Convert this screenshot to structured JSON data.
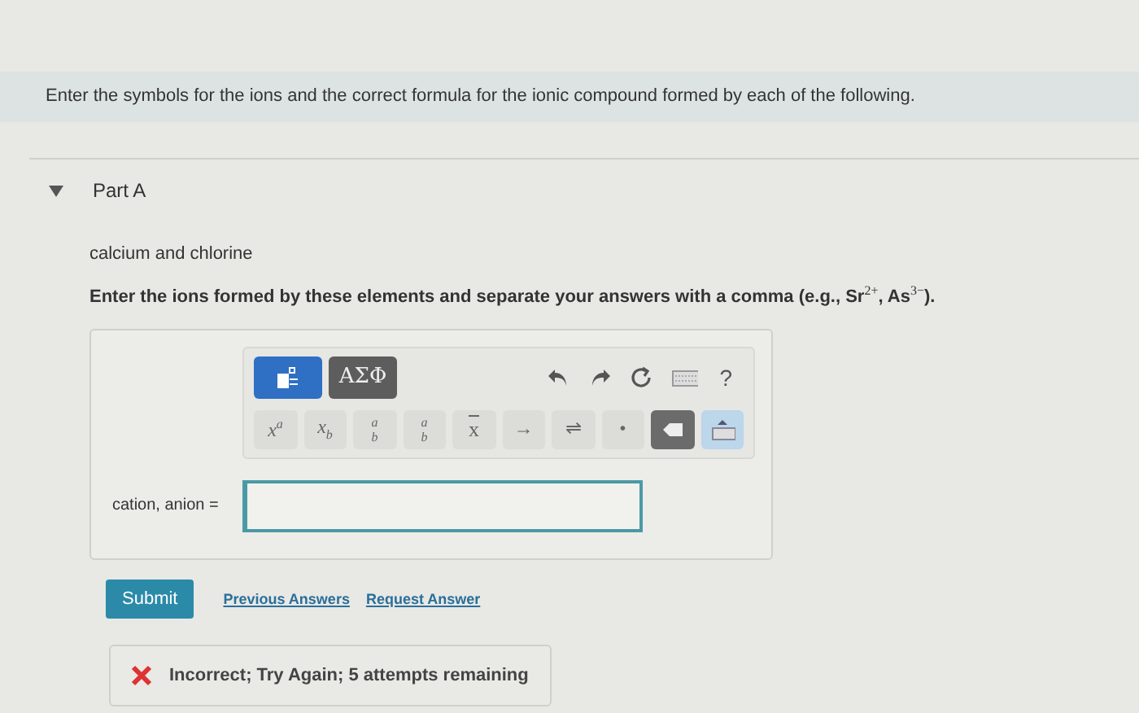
{
  "instructions": "Enter the symbols for the ions and the correct formula for the ionic compound formed by each of the following.",
  "part": {
    "title": "Part A",
    "expanded": true
  },
  "elements": "calcium and chlorine",
  "prompt": "Enter the ions formed by these elements and separate your answers with a comma (e.g., Sr$^{2+}$, As$^{3−}$).",
  "toolbar_top": [
    {
      "kind": "templates",
      "selected": true
    },
    {
      "kind": "symbols",
      "label": "ΑΣΦ",
      "selected": false
    },
    {
      "kind": "undo"
    },
    {
      "kind": "redo"
    },
    {
      "kind": "reset"
    },
    {
      "kind": "keyboard"
    },
    {
      "kind": "help",
      "label": "?"
    }
  ],
  "toolbar_bottom": [
    {
      "kind": "superscript",
      "base": "x",
      "script": "a"
    },
    {
      "kind": "subscript",
      "base": "x",
      "script": "b"
    },
    {
      "kind": "stack",
      "top": "a",
      "bottom": "b"
    },
    {
      "kind": "fraction",
      "top": "a",
      "bottom": "b"
    },
    {
      "kind": "bar",
      "base": "x"
    },
    {
      "kind": "glyph",
      "label": "→"
    },
    {
      "kind": "glyph",
      "label": "⇌"
    },
    {
      "kind": "glyph",
      "label": "•"
    },
    {
      "kind": "backspace"
    },
    {
      "kind": "keyboard-toggle"
    }
  ],
  "answer": {
    "label": "cation, anion ="
  },
  "actions": {
    "submit": "Submit",
    "links": [
      "Previous Answers",
      "Request Answer"
    ]
  },
  "feedback": {
    "correct": false,
    "message": "Incorrect; Try Again; 5 attempts remaining"
  }
}
